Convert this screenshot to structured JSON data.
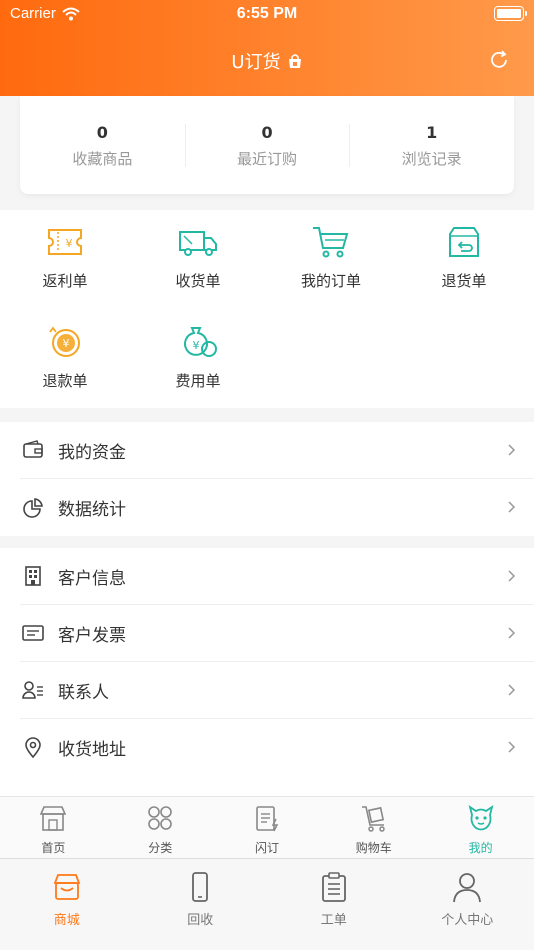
{
  "status_bar": {
    "carrier": "Carrier",
    "time": "6:55 PM"
  },
  "nav": {
    "title": "U订货"
  },
  "stats": [
    {
      "count": "0",
      "label": "收藏商品"
    },
    {
      "count": "0",
      "label": "最近订购"
    },
    {
      "count": "1",
      "label": "浏览记录"
    }
  ],
  "orders": [
    {
      "label": "返利单",
      "icon": "rebate-ticket-icon"
    },
    {
      "label": "收货单",
      "icon": "delivery-truck-icon"
    },
    {
      "label": "我的订单",
      "icon": "shopping-cart-icon"
    },
    {
      "label": "退货单",
      "icon": "return-box-icon"
    },
    {
      "label": "退款单",
      "icon": "refund-coin-icon"
    },
    {
      "label": "费用单",
      "icon": "money-bag-icon"
    }
  ],
  "menu_group1": [
    {
      "label": "我的资金",
      "icon": "wallet-icon"
    },
    {
      "label": "数据统计",
      "icon": "pie-chart-icon"
    }
  ],
  "menu_group2": [
    {
      "label": "客户信息",
      "icon": "building-icon"
    },
    {
      "label": "客户发票",
      "icon": "invoice-icon"
    },
    {
      "label": "联系人",
      "icon": "contact-icon"
    },
    {
      "label": "收货地址",
      "icon": "location-pin-icon"
    }
  ],
  "tabbar_inner": [
    {
      "label": "首页",
      "icon": "store-icon"
    },
    {
      "label": "分类",
      "icon": "category-icon"
    },
    {
      "label": "闪订",
      "icon": "quick-order-icon"
    },
    {
      "label": "购物车",
      "icon": "cart-icon"
    },
    {
      "label": "我的",
      "icon": "mascot-icon",
      "active": true
    }
  ],
  "tabbar_outer": [
    {
      "label": "商城",
      "icon": "mall-icon",
      "active": true
    },
    {
      "label": "回收",
      "icon": "phone-icon"
    },
    {
      "label": "工单",
      "icon": "clipboard-icon"
    },
    {
      "label": "个人中心",
      "icon": "user-icon"
    }
  ],
  "colors": {
    "brand_orange": "#ff7a1a",
    "accent_teal": "#23b8a4",
    "icon_orange": "#f5a623"
  }
}
